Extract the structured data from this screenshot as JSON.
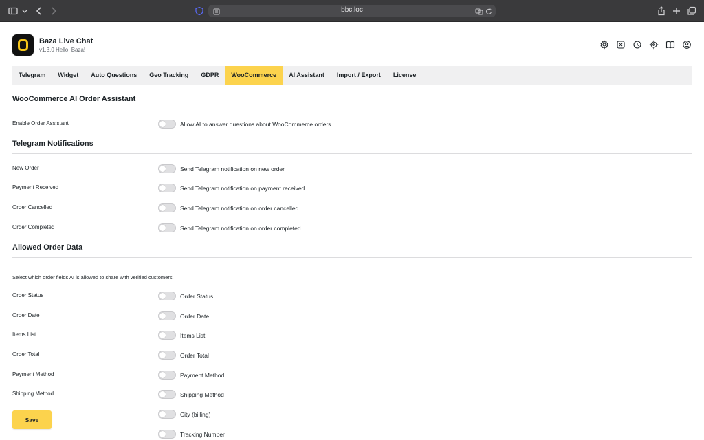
{
  "browser": {
    "url": "bbc.loc",
    "icons": [
      "sidebar-icon",
      "chevron-down-icon",
      "back-icon",
      "forward-icon",
      "shield-icon",
      "page-icon",
      "translate-icon",
      "reload-icon",
      "share-icon",
      "new-tab-icon",
      "tabs-overview-icon"
    ]
  },
  "app": {
    "title": "Baza Live Chat",
    "subtitle": "v1.3.0 Hello, Baza!",
    "brand_color": "#fcd34d",
    "header_icons": [
      "settings-icon",
      "close-square-icon",
      "clock-icon",
      "target-icon",
      "book-icon",
      "user-icon"
    ]
  },
  "tabs": [
    {
      "label": "Telegram",
      "active": false
    },
    {
      "label": "Widget",
      "active": false
    },
    {
      "label": "Auto Questions",
      "active": false
    },
    {
      "label": "Geo Tracking",
      "active": false
    },
    {
      "label": "GDPR",
      "active": false
    },
    {
      "label": "WooCommerce",
      "active": true
    },
    {
      "label": "AI Assistant",
      "active": false
    },
    {
      "label": "Import / Export",
      "active": false
    },
    {
      "label": "License",
      "active": false
    }
  ],
  "sections": {
    "ai_assistant": {
      "title": "WooCommerce AI Order Assistant",
      "rows": [
        {
          "label": "Enable Order Assistant",
          "desc": "Allow AI to answer questions about WooCommerce orders",
          "on": false
        }
      ]
    },
    "telegram": {
      "title": "Telegram Notifications",
      "rows": [
        {
          "label": "New Order",
          "desc": "Send Telegram notification on new order",
          "on": false
        },
        {
          "label": "Payment Received",
          "desc": "Send Telegram notification on payment received",
          "on": false
        },
        {
          "label": "Order Cancelled",
          "desc": "Send Telegram notification on order cancelled",
          "on": false
        },
        {
          "label": "Order Completed",
          "desc": "Send Telegram notification on order completed",
          "on": false
        }
      ]
    },
    "order_data": {
      "title": "Allowed Order Data",
      "helper": "Select which order fields AI is allowed to share with verified customers.",
      "rows": [
        {
          "label": "Order Status",
          "desc": "Order Status",
          "on": false
        },
        {
          "label": "Order Date",
          "desc": "Order Date",
          "on": false
        },
        {
          "label": "Items List",
          "desc": "Items List",
          "on": false
        },
        {
          "label": "Order Total",
          "desc": "Order Total",
          "on": false
        },
        {
          "label": "Payment Method",
          "desc": "Payment Method",
          "on": false
        },
        {
          "label": "Shipping Method",
          "desc": "Shipping Method",
          "on": false
        },
        {
          "label": "",
          "desc": "City (billing)",
          "on": false
        },
        {
          "label": "",
          "desc": "Tracking Number",
          "on": false
        }
      ]
    }
  },
  "save_label": "Save"
}
